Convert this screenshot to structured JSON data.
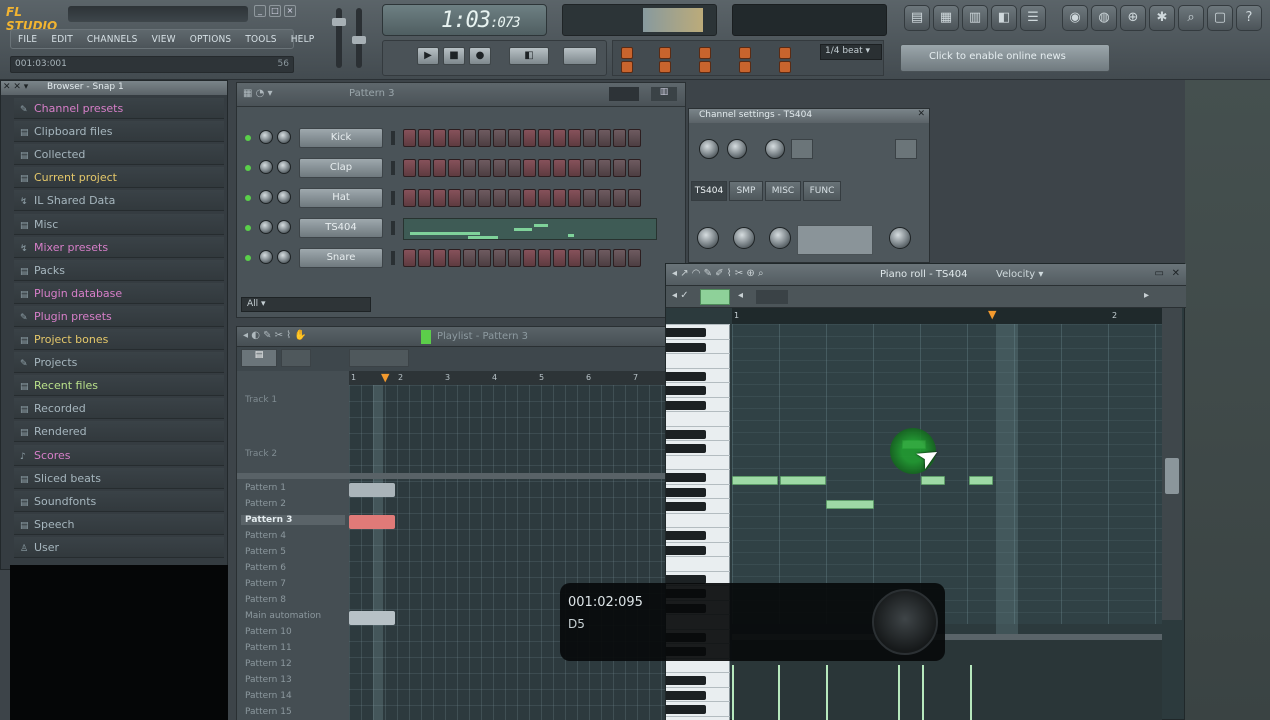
{
  "app": {
    "logo": "FL STUDIO",
    "menu": [
      "FILE",
      "EDIT",
      "CHANNELS",
      "VIEW",
      "OPTIONS",
      "TOOLS",
      "HELP"
    ],
    "hint_value": "001:03:001",
    "hint_mark": "56"
  },
  "transport": {
    "time_main": "1:03",
    "time_ms": ":073",
    "snap": "1/4 beat",
    "news": "Click to enable online news"
  },
  "browser": {
    "title": "Browser - Snap 1",
    "items": [
      {
        "label": "Channel presets",
        "color": "#d77fc9"
      },
      {
        "label": "Clipboard files",
        "color": "#a6b6be"
      },
      {
        "label": "Collected",
        "color": "#a6b6be"
      },
      {
        "label": "Current project",
        "color": "#e5c86a"
      },
      {
        "label": "IL Shared Data",
        "color": "#a6b6be"
      },
      {
        "label": "Misc",
        "color": "#a6b6be"
      },
      {
        "label": "Mixer presets",
        "color": "#d77fc9"
      },
      {
        "label": "Packs",
        "color": "#a6b6be"
      },
      {
        "label": "Plugin database",
        "color": "#d77fc9"
      },
      {
        "label": "Plugin presets",
        "color": "#d77fc9"
      },
      {
        "label": "Project bones",
        "color": "#e5c86a"
      },
      {
        "label": "Projects",
        "color": "#a6b6be"
      },
      {
        "label": "Recent files",
        "color": "#b9e08a"
      },
      {
        "label": "Recorded",
        "color": "#a6b6be"
      },
      {
        "label": "Rendered",
        "color": "#a6b6be"
      },
      {
        "label": "Scores",
        "color": "#d77fc9"
      },
      {
        "label": "Sliced beats",
        "color": "#a6b6be"
      },
      {
        "label": "Soundfonts",
        "color": "#a6b6be"
      },
      {
        "label": "Speech",
        "color": "#a6b6be"
      },
      {
        "label": "User",
        "color": "#a6b6be"
      }
    ]
  },
  "stepseq": {
    "title": "Pattern 3",
    "channels": [
      {
        "name": "Kick"
      },
      {
        "name": "Clap"
      },
      {
        "name": "Hat"
      },
      {
        "name": "TS404"
      },
      {
        "name": "Snare"
      }
    ],
    "filter": "All"
  },
  "channel_settings": {
    "title": "Channel settings - TS404",
    "tabs": [
      "TS404",
      "SMP",
      "MISC",
      "FUNC"
    ]
  },
  "playlist": {
    "title": "Playlist - Pattern 3",
    "tracks": [
      "Track 1",
      "Track 2"
    ],
    "patterns": [
      "Pattern 1",
      "Pattern 2",
      "Pattern 3",
      "Pattern 4",
      "Pattern 5",
      "Pattern 6",
      "Pattern 7",
      "Pattern 8",
      "Main automation",
      "Pattern 10",
      "Pattern 11",
      "Pattern 12",
      "Pattern 13",
      "Pattern 14",
      "Pattern 15"
    ],
    "selected_pattern": "Pattern 3",
    "ruler": [
      "1",
      "2",
      "3",
      "4",
      "5",
      "6",
      "7"
    ]
  },
  "pianoroll": {
    "title": "Piano roll - TS404",
    "target": "Velocity",
    "ruler": [
      "1",
      "2"
    ]
  },
  "popup": {
    "time": "001:02:095",
    "note": "D5"
  }
}
